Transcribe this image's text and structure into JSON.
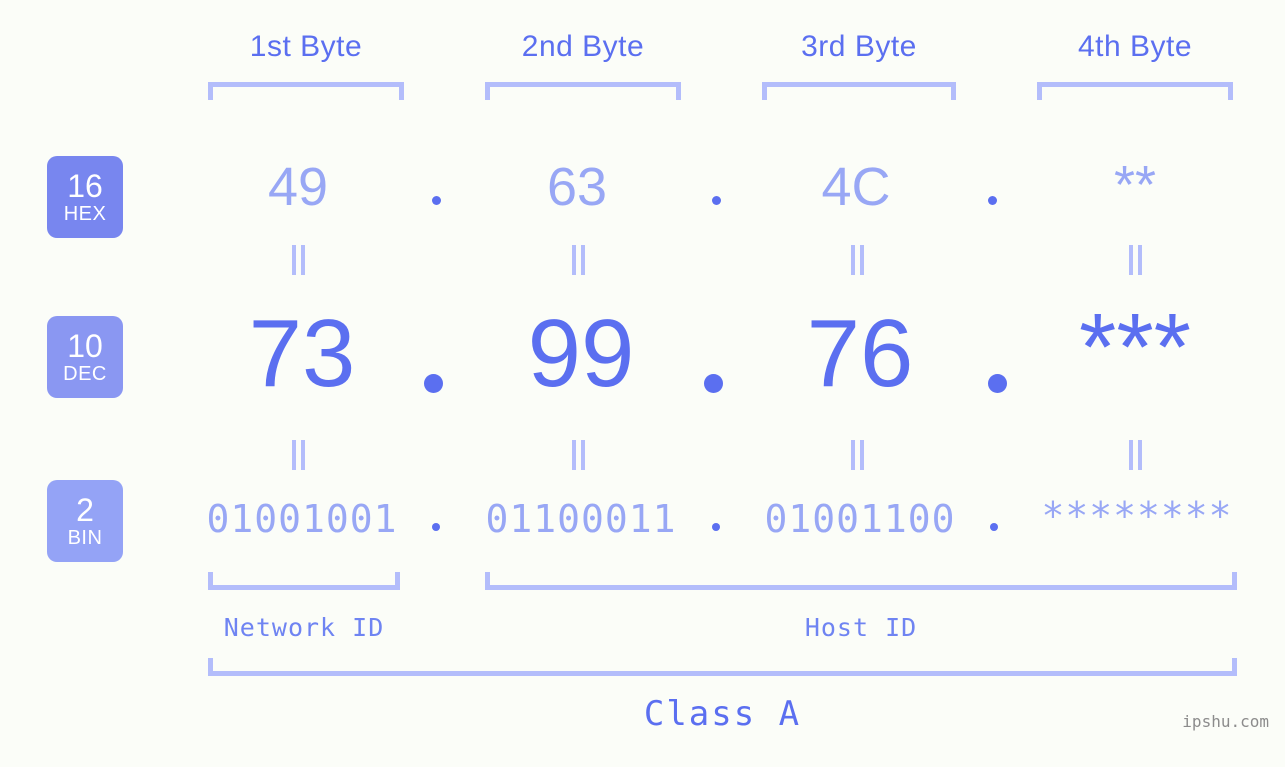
{
  "headers": [
    {
      "label": "1st Byte"
    },
    {
      "label": "2nd Byte"
    },
    {
      "label": "3rd Byte"
    },
    {
      "label": "4th Byte"
    }
  ],
  "bases": [
    {
      "num": "16",
      "label": "HEX",
      "color": "#7886ef"
    },
    {
      "num": "10",
      "label": "DEC",
      "color": "#8a97f2"
    },
    {
      "num": "2",
      "label": "BIN",
      "color": "#94a3f6"
    }
  ],
  "rows": {
    "hex": {
      "values": [
        "49",
        "63",
        "4C",
        "**"
      ]
    },
    "dec": {
      "values": [
        "73",
        "99",
        "76",
        "***"
      ]
    },
    "bin": {
      "values": [
        "01001001",
        "01100011",
        "01001100",
        "********"
      ]
    }
  },
  "separators": {
    "glyph": "."
  },
  "equals": {
    "glyph": "="
  },
  "segments": {
    "network_id": "Network ID",
    "host_id": "Host ID",
    "class": "Class A"
  },
  "watermark": "ipshu.com",
  "colors": {
    "background": "#fbfdf8",
    "accent": "#5b6ff0",
    "accent_light": "#98a7f5",
    "bracket": "#b3bdfb",
    "badge_hex": "#7886ef",
    "badge_dec": "#8a97f2",
    "badge_bin": "#94a3f6",
    "watermark": "#8c8c8c"
  }
}
